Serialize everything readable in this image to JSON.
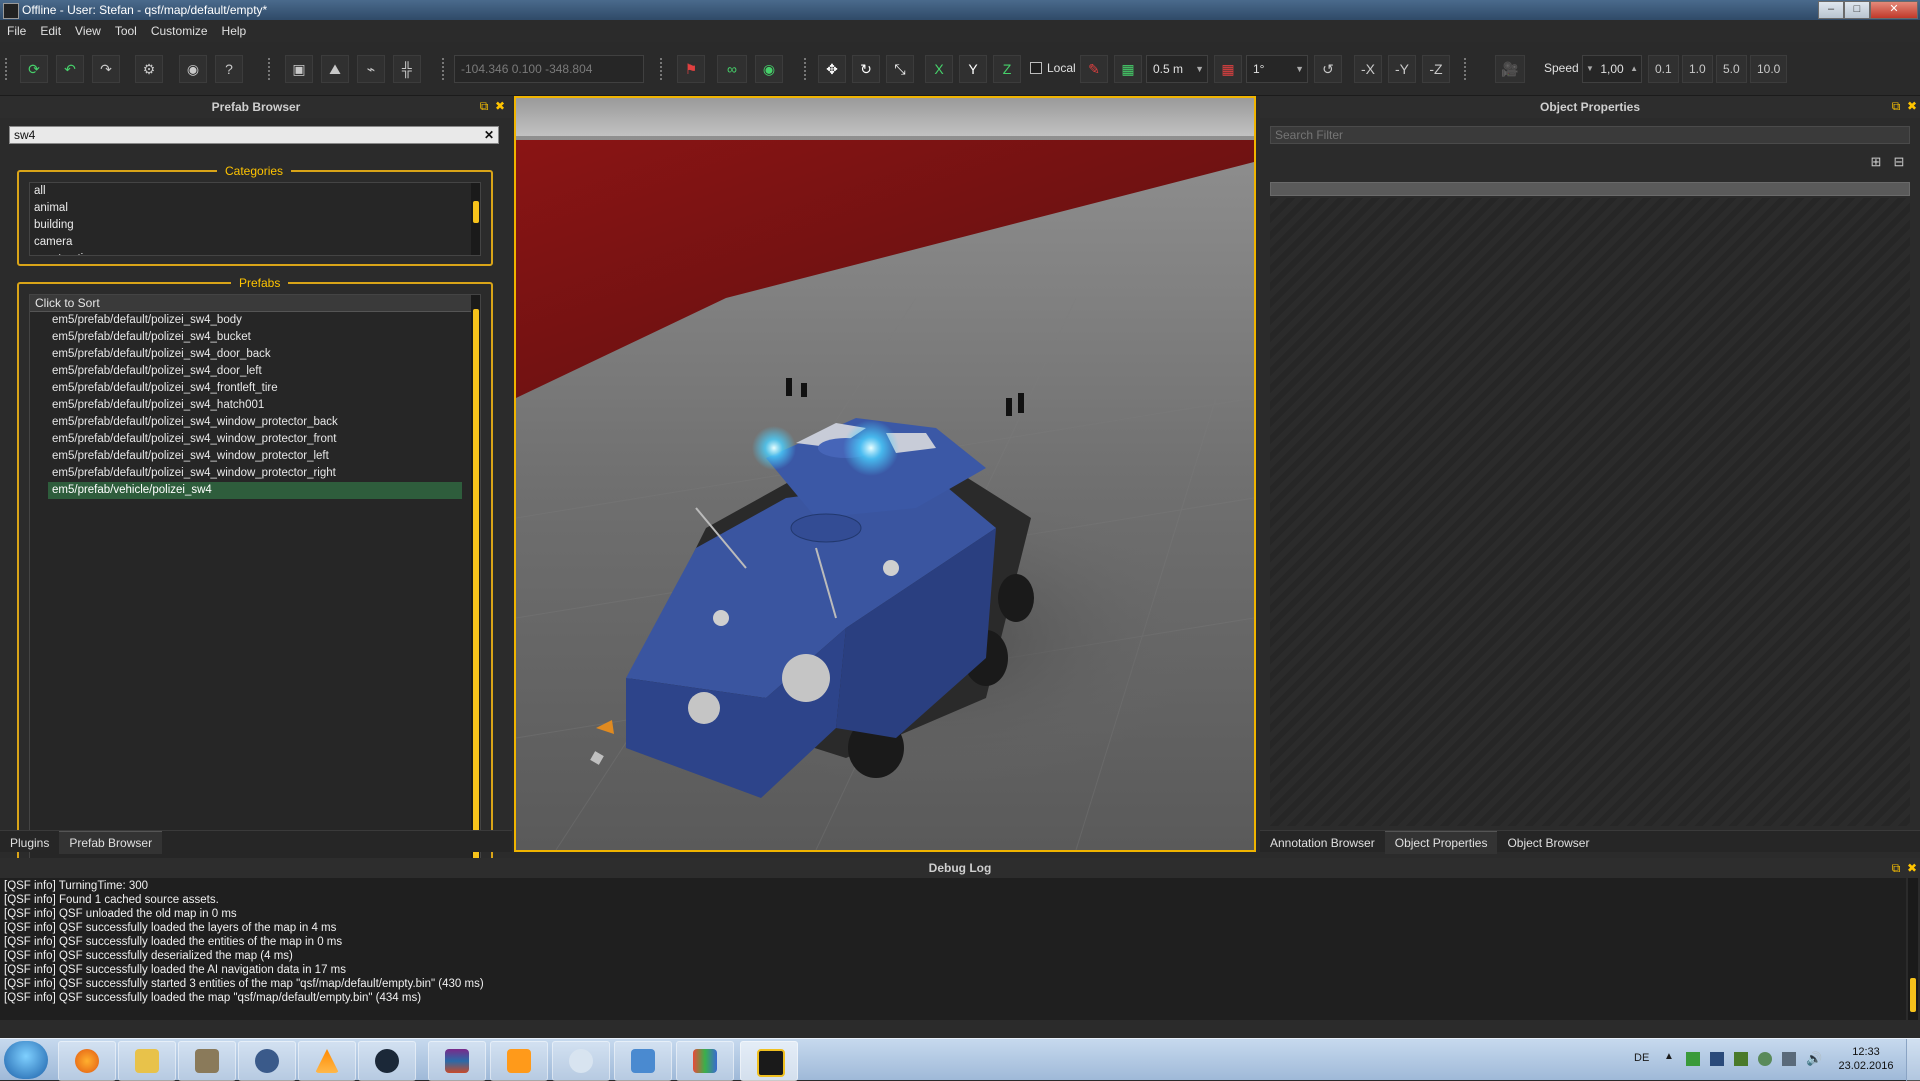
{
  "window": {
    "title": "Offline - User: Stefan - qsf/map/default/empty*"
  },
  "menu": [
    "File",
    "Edit",
    "View",
    "Tool",
    "Customize",
    "Help"
  ],
  "toolbar": {
    "coordinates": "-104.346 0.100 -348.804",
    "axes": [
      "X",
      "Y",
      "Z"
    ],
    "local_label": "Local",
    "grid_size": "0.5 m",
    "rotation_step": "1°",
    "neg_axes": [
      "-X",
      "-Y",
      "-Z"
    ],
    "speed_label": "Speed",
    "speed_value": "1,00",
    "speed_presets": [
      "0.1",
      "1.0",
      "5.0",
      "10.0"
    ]
  },
  "prefab_browser": {
    "title": "Prefab Browser",
    "search_value": "sw4",
    "categories_title": "Categories",
    "categories": [
      "all",
      "animal",
      "building",
      "camera",
      "construction"
    ],
    "prefabs_title": "Prefabs",
    "sort_header": "Click to Sort",
    "prefabs": [
      "em5/prefab/default/polizei_sw4_body",
      "em5/prefab/default/polizei_sw4_bucket",
      "em5/prefab/default/polizei_sw4_door_back",
      "em5/prefab/default/polizei_sw4_door_left",
      "em5/prefab/default/polizei_sw4_frontleft_tire",
      "em5/prefab/default/polizei_sw4_hatch001",
      "em5/prefab/default/polizei_sw4_window_protector_back",
      "em5/prefab/default/polizei_sw4_window_protector_front",
      "em5/prefab/default/polizei_sw4_window_protector_left",
      "em5/prefab/default/polizei_sw4_window_protector_right",
      "em5/prefab/vehicle/polizei_sw4"
    ],
    "selected_index": 10,
    "tabs": [
      "Plugins",
      "Prefab Browser"
    ]
  },
  "object_properties": {
    "title": "Object Properties",
    "search_placeholder": "Search Filter",
    "tabs": [
      "Annotation Browser",
      "Object Properties",
      "Object Browser"
    ]
  },
  "debug_log": {
    "title": "Debug Log",
    "lines": [
      "[QSF info] TurningTime: 300",
      "[QSF info] Found 1 cached source assets.",
      "[QSF info] QSF unloaded the old map in 0 ms",
      "[QSF info] QSF successfully loaded the layers of the map in 4 ms",
      "[QSF info] QSF successfully loaded the entities of the map in 0 ms",
      "[QSF info] QSF successfully deserialized the map (4 ms)",
      "[QSF info] QSF successfully loaded the AI navigation data in 17 ms",
      "[QSF info] QSF successfully started 3 entities of the map \"qsf/map/default/empty.bin\" (430 ms)",
      "[QSF info] QSF successfully loaded the map \"qsf/map/default/empty.bin\" (434 ms)"
    ]
  },
  "taskbar": {
    "language": "DE",
    "time": "12:33",
    "date": "23.02.2016",
    "apps": [
      "firefox-icon",
      "explorer-icon",
      "gimp-icon",
      "audacity-icon",
      "vlc-icon",
      "steam-icon",
      "winrar-icon",
      "amazon-icon",
      "paint-icon",
      "photos-icon",
      "calculator-icon",
      "emergency-editor-icon"
    ]
  }
}
